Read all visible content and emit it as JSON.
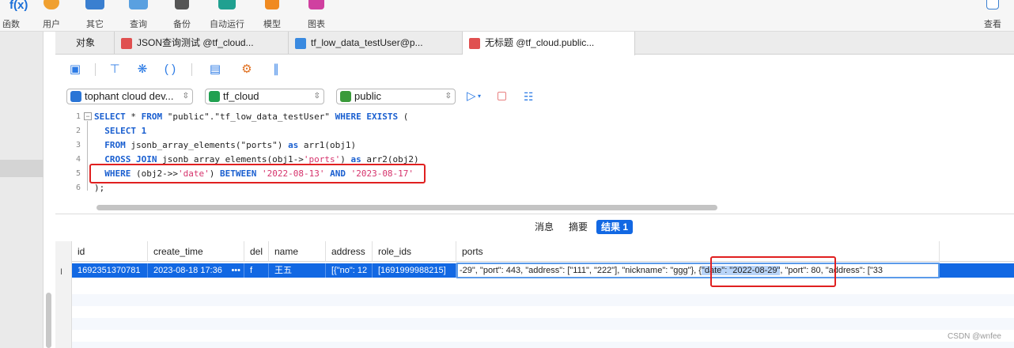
{
  "toolbar": {
    "items": [
      {
        "label": "函数",
        "icon": "function-icon",
        "partial_text": "f(x)"
      },
      {
        "label": "用户",
        "icon": "user-icon"
      },
      {
        "label": "其它",
        "icon": "other-icon"
      },
      {
        "label": "查询",
        "icon": "query-icon"
      },
      {
        "label": "备份",
        "icon": "backup-icon"
      },
      {
        "label": "自动运行",
        "icon": "robot-icon"
      },
      {
        "label": "模型",
        "icon": "model-icon"
      },
      {
        "label": "图表",
        "icon": "chart-icon"
      },
      {
        "label": "查看",
        "icon": "view-icon"
      }
    ]
  },
  "tabs": [
    {
      "label": "对象"
    },
    {
      "label": "JSON查询测试 @tf_cloud..."
    },
    {
      "label": "tf_low_data_testUser@p..."
    },
    {
      "label": "无标题 @tf_cloud.public..."
    }
  ],
  "connection": {
    "server": "tophant cloud dev...",
    "database": "tf_cloud",
    "schema": "public"
  },
  "editor": {
    "line_numbers": [
      "1",
      "2",
      "3",
      "4",
      "5",
      "6"
    ],
    "lines": [
      [
        {
          "t": "SELECT",
          "c": "kw"
        },
        {
          "t": " * "
        },
        {
          "t": "FROM",
          "c": "kw"
        },
        {
          "t": " \"public\".\"tf_low_data_testUser\" "
        },
        {
          "t": "WHERE EXISTS",
          "c": "kw"
        },
        {
          "t": " ("
        }
      ],
      [
        {
          "t": "  "
        },
        {
          "t": "SELECT",
          "c": "kw"
        },
        {
          "t": " "
        },
        {
          "t": "1",
          "c": "kw"
        }
      ],
      [
        {
          "t": "  "
        },
        {
          "t": "FROM",
          "c": "kw"
        },
        {
          "t": " jsonb_array_elements(\"ports\") "
        },
        {
          "t": "as",
          "c": "kw"
        },
        {
          "t": " arr1(obj1)"
        }
      ],
      [
        {
          "t": "  "
        },
        {
          "t": "CROSS JOIN",
          "c": "kw"
        },
        {
          "t": " jsonb_array_elements(obj1->"
        },
        {
          "t": "'ports'",
          "c": "str"
        },
        {
          "t": ") "
        },
        {
          "t": "as",
          "c": "kw"
        },
        {
          "t": " arr2(obj2)"
        }
      ],
      [
        {
          "t": "  "
        },
        {
          "t": "WHERE",
          "c": "kw"
        },
        {
          "t": " (obj2->>"
        },
        {
          "t": "'date'",
          "c": "str"
        },
        {
          "t": ") "
        },
        {
          "t": "BETWEEN",
          "c": "kw"
        },
        {
          "t": " "
        },
        {
          "t": "'2022-08-13'",
          "c": "str"
        },
        {
          "t": " "
        },
        {
          "t": "AND",
          "c": "kw"
        },
        {
          "t": " "
        },
        {
          "t": "'2023-08-17'",
          "c": "str"
        }
      ],
      [
        {
          "t": ");"
        }
      ]
    ]
  },
  "result_tabs": [
    {
      "label": "消息"
    },
    {
      "label": "摘要"
    },
    {
      "label": "结果 1",
      "active": true
    }
  ],
  "grid": {
    "row_marker": "I",
    "columns": [
      "id",
      "create_time",
      "del",
      "name",
      "address",
      "role_ids",
      "ports"
    ],
    "row": {
      "id": "1692351370781",
      "create_time": "2023-08-18 17:36",
      "create_time_more": "•••",
      "del": "f",
      "name": "王五",
      "address": "[{\"no\": 12",
      "role_ids": "[1691999988215]",
      "ports_before": "-29\", \"port\": 443, \"address\": [\"111\", \"222\"], \"nickname\": \"ggg\"}, {",
      "ports_selected": "\"date\": \"2022-08-29\"",
      "ports_after": ", \"port\": 80, \"address\": [\"33"
    }
  },
  "watermark": "CSDN @wnfee",
  "colors": {
    "accent": "#1268e3",
    "keyword": "#1a5fd0",
    "string": "#d6336c",
    "annotation_box": "#e02020"
  }
}
